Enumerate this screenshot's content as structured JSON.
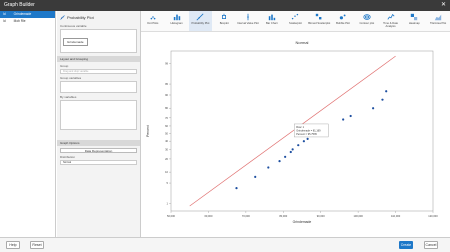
{
  "window": {
    "title": "Graph Builder",
    "close": "✕"
  },
  "left_list": [
    {
      "col1": "Id",
      "col2": "Grindemade",
      "selected": true
    },
    {
      "col1": "Id",
      "col2": "Mob Rle",
      "selected": false
    }
  ],
  "config": {
    "plot_title": "Probability Plot",
    "continuous_label": "Continuous variable",
    "chip": "Grindemade",
    "layout_section": "Layout and Grouping",
    "group_label": "Group",
    "group_placeholder": "Drag and drop variable",
    "group_vars_label": "Group variables",
    "by_vars_label": "By variables",
    "graph_options": "Graph Options",
    "data_repr_label": "Data Representation",
    "distribution_label": "Distribution",
    "distribution_value": "Normal"
  },
  "toolbar": [
    {
      "label": "Dot Plots",
      "icon": "dot-plot-icon"
    },
    {
      "label": "Histogram",
      "icon": "histogram-icon"
    },
    {
      "label": "Probability Plot",
      "icon": "probability-plot-icon",
      "active": true
    },
    {
      "label": "Boxplot",
      "icon": "boxplot-icon"
    },
    {
      "label": "Interval Value Plot",
      "icon": "interval-plot-icon"
    },
    {
      "label": "Bar Chart",
      "icon": "bar-chart-icon"
    },
    {
      "label": "Scatterplot",
      "icon": "scatterplot-icon"
    },
    {
      "label": "Binned Scatterplot",
      "icon": "binned-scatterplot-icon"
    },
    {
      "label": "Bubble Plot",
      "icon": "bubble-plot-icon"
    },
    {
      "label": "Contour plot",
      "icon": "contour-plot-icon"
    },
    {
      "label": "Time & Date Analysis",
      "icon": "time-series-icon"
    },
    {
      "label": "Heatmap",
      "icon": "heatmap-icon"
    },
    {
      "label": "Tile/Area Plot",
      "icon": "area-plot-icon"
    }
  ],
  "tooltip": {
    "line1": "Row: 1",
    "line2": "Grindemade = 81,169",
    "line3": "Percent = 95.7535"
  },
  "chart_data": {
    "type": "scatter",
    "title": "Normal",
    "xlabel": "Grindemade",
    "ylabel": "Percent",
    "x_ticks": [
      "50,000",
      "60,000",
      "70,000",
      "80,000",
      "90,000",
      "100,000",
      "110,000",
      "120,000"
    ],
    "y_ticks": [
      "1",
      "5",
      "10",
      "20",
      "30",
      "40",
      "50",
      "60",
      "70",
      "80",
      "90",
      "95",
      "99"
    ],
    "xlim": [
      50000,
      120000
    ],
    "line": {
      "x": [
        55000,
        110000
      ],
      "p": [
        0.8,
        99.5
      ]
    },
    "points": [
      {
        "x": 67500,
        "p": 3.5
      },
      {
        "x": 72500,
        "p": 7.5
      },
      {
        "x": 76000,
        "p": 13
      },
      {
        "x": 79000,
        "p": 18
      },
      {
        "x": 80500,
        "p": 22
      },
      {
        "x": 82000,
        "p": 27
      },
      {
        "x": 82500,
        "p": 30
      },
      {
        "x": 84000,
        "p": 35
      },
      {
        "x": 85500,
        "p": 40
      },
      {
        "x": 86500,
        "p": 43
      },
      {
        "x": 88000,
        "p": 47
      },
      {
        "x": 91000,
        "p": 57
      },
      {
        "x": 96000,
        "p": 68
      },
      {
        "x": 98000,
        "p": 72
      },
      {
        "x": 104000,
        "p": 80
      },
      {
        "x": 106500,
        "p": 87
      },
      {
        "x": 107500,
        "p": 92
      }
    ],
    "grid": false,
    "line_color": "#e07070",
    "point_color": "#1e4fa0"
  },
  "footer": {
    "help": "Help",
    "reset": "Reset",
    "create": "Create",
    "cancel": "Cancel"
  }
}
